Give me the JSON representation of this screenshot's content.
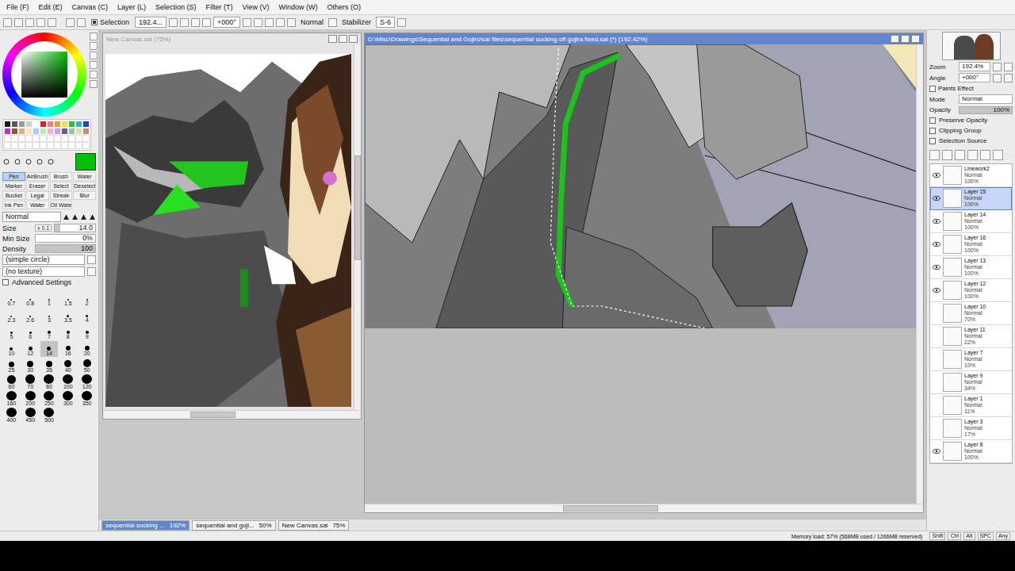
{
  "menu": [
    "File (F)",
    "Edit (E)",
    "Canvas (C)",
    "Layer (L)",
    "Selection (S)",
    "Filter (T)",
    "View (V)",
    "Window (W)",
    "Others (O)"
  ],
  "toolbar": {
    "selection_label": "Selection",
    "selection_checked": true,
    "zoom": "192.4...",
    "angle": "+000°",
    "mode": "Normal",
    "stabilizer_label": "Stabilizer",
    "stabilizer": "S-6"
  },
  "color": {
    "current": "#00c000"
  },
  "swatches": [
    "#1a1a1a",
    "#5a5a5a",
    "#9a9a9a",
    "#d0d0d0",
    "#ffffff",
    "#e02020",
    "#f08080",
    "#f0a020",
    "#f0e040",
    "#30c030",
    "#20c0c0",
    "#2040e0",
    "#c030c0",
    "#8a5a30",
    "#d8b080",
    "#ffe0c8",
    "#a0d0ff",
    "#b0f0b0",
    "#ffb0d0",
    "#c0a0ff",
    "#606090",
    "#90c0c0",
    "#e0e0a0",
    "#c09070"
  ],
  "tools": [
    {
      "label": "Pen",
      "selected": true
    },
    {
      "label": "AirBrush",
      "selected": false
    },
    {
      "label": "Brush",
      "selected": false
    },
    {
      "label": "Water",
      "selected": false
    },
    {
      "label": "Marker",
      "selected": false
    },
    {
      "label": "Eraser",
      "selected": false
    },
    {
      "label": "Select",
      "selected": false
    },
    {
      "label": "Deselect",
      "selected": false
    },
    {
      "label": "Bucket",
      "selected": false
    },
    {
      "label": "Legal",
      "selected": false
    },
    {
      "label": "Streak",
      "selected": false
    },
    {
      "label": "Blur",
      "selected": false
    },
    {
      "label": "Ink Pen",
      "selected": false
    },
    {
      "label": "Water",
      "selected": false
    },
    {
      "label": "Oil Water",
      "selected": false
    }
  ],
  "brush": {
    "mode": "Normal",
    "size_label": "Size",
    "size_multiplier": "x 0.1",
    "size": "14.0",
    "size_level": 0.14,
    "min_size_label": "Min Size",
    "min_size": "0%",
    "min_size_level": 0,
    "density_label": "Density",
    "density": "100",
    "density_level": 1,
    "shape": "(simple circle)",
    "texture": "(no texture)",
    "advanced_label": "Advanced Settings",
    "advanced_open": false
  },
  "brush_sizes": [
    {
      "label": "0.7",
      "selected": false
    },
    {
      "label": "0.8",
      "selected": false
    },
    {
      "label": "1",
      "selected": false
    },
    {
      "label": "1.5",
      "selected": false
    },
    {
      "label": "2",
      "selected": false
    },
    {
      "label": "2.3",
      "selected": false
    },
    {
      "label": "2.6",
      "selected": false
    },
    {
      "label": "3",
      "selected": false
    },
    {
      "label": "3.5",
      "selected": false
    },
    {
      "label": "4",
      "selected": false
    },
    {
      "label": "5",
      "selected": false
    },
    {
      "label": "6",
      "selected": false
    },
    {
      "label": "7",
      "selected": false
    },
    {
      "label": "8",
      "selected": false
    },
    {
      "label": "9",
      "selected": false
    },
    {
      "label": "10",
      "selected": false
    },
    {
      "label": "12",
      "selected": false
    },
    {
      "label": "14",
      "selected": true
    },
    {
      "label": "16",
      "selected": false
    },
    {
      "label": "20",
      "selected": false
    },
    {
      "label": "25",
      "selected": false
    },
    {
      "label": "30",
      "selected": false
    },
    {
      "label": "35",
      "selected": false
    },
    {
      "label": "40",
      "selected": false
    },
    {
      "label": "50",
      "selected": false
    },
    {
      "label": "60",
      "selected": false
    },
    {
      "label": "70",
      "selected": false
    },
    {
      "label": "80",
      "selected": false
    },
    {
      "label": "100",
      "selected": false
    },
    {
      "label": "120",
      "selected": false
    },
    {
      "label": "160",
      "selected": false
    },
    {
      "label": "200",
      "selected": false
    },
    {
      "label": "250",
      "selected": false
    },
    {
      "label": "300",
      "selected": false
    },
    {
      "label": "350",
      "selected": false
    },
    {
      "label": "400",
      "selected": false
    },
    {
      "label": "450",
      "selected": false
    },
    {
      "label": "500",
      "selected": false
    }
  ],
  "navigator_window": {
    "title": "New Canvas.sai (75%)",
    "active": false
  },
  "canvas_window": {
    "title": "D:\\Misc\\Drawings\\Sequential and Gojiro\\sai files\\sequential sucking off gojira fixed.sai (*) (192.42%)",
    "active": true
  },
  "right": {
    "zoom_label": "Zoom",
    "zoom": "192.4%",
    "angle_label": "Angle",
    "angle": "+000°",
    "paints_effect": "Paints Effect",
    "mode_label": "Mode",
    "mode": "Normal",
    "opacity_label": "Opacity",
    "opacity": "100%",
    "opacity_level": 1,
    "options": [
      {
        "label": "Preserve Opacity",
        "checked": false
      },
      {
        "label": "Clipping Group",
        "checked": false
      },
      {
        "label": "Selection Source",
        "checked": false
      }
    ]
  },
  "layers": [
    {
      "name": "Linework2",
      "mode": "Normal",
      "opacity": "100%",
      "visible": true,
      "selected": false
    },
    {
      "name": "Layer 15",
      "mode": "Normal",
      "opacity": "100%",
      "visible": true,
      "selected": true
    },
    {
      "name": "Layer 14",
      "mode": "Normal",
      "opacity": "100%",
      "visible": true,
      "selected": false
    },
    {
      "name": "Layer 16",
      "mode": "Normal",
      "opacity": "100%",
      "visible": true,
      "selected": false
    },
    {
      "name": "Layer 13",
      "mode": "Normal",
      "opacity": "100%",
      "visible": true,
      "selected": false
    },
    {
      "name": "Layer 12",
      "mode": "Normal",
      "opacity": "100%",
      "visible": true,
      "selected": false
    },
    {
      "name": "Layer 10",
      "mode": "Normal",
      "opacity": "70%",
      "visible": false,
      "selected": false
    },
    {
      "name": "Layer 11",
      "mode": "Normal",
      "opacity": "22%",
      "visible": false,
      "selected": false
    },
    {
      "name": "Layer 7",
      "mode": "Normal",
      "opacity": "10%",
      "visible": false,
      "selected": false
    },
    {
      "name": "Layer 9",
      "mode": "Normal",
      "opacity": "34%",
      "visible": false,
      "selected": false
    },
    {
      "name": "Layer 1",
      "mode": "Normal",
      "opacity": "11%",
      "visible": false,
      "selected": false
    },
    {
      "name": "Layer 3",
      "mode": "Normal",
      "opacity": "17%",
      "visible": false,
      "selected": false
    },
    {
      "name": "Layer 8",
      "mode": "Normal",
      "opacity": "100%",
      "visible": true,
      "selected": false
    }
  ],
  "doc_tabs": [
    {
      "label": "sequential sucking ...",
      "zoom": "192%",
      "selected": true
    },
    {
      "label": "sequential and goji...",
      "zoom": "50%",
      "selected": false
    },
    {
      "label": "New Canvas.sai",
      "zoom": "75%",
      "selected": false
    }
  ],
  "status": {
    "memory": "Memory load: 57% (568MB used / 1266MB reserved)",
    "keys": [
      "Shift",
      "Ctrl",
      "Alt",
      "SPC",
      "Any"
    ]
  }
}
